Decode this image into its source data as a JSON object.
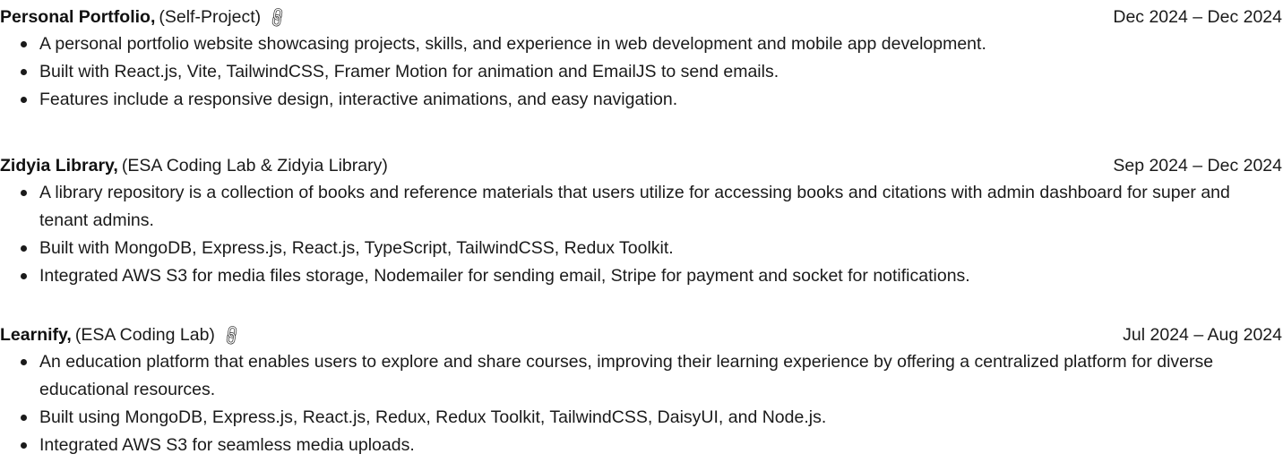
{
  "projects": [
    {
      "name": "Personal Portfolio,",
      "org": "(Self-Project)",
      "has_link": true,
      "link_icon": "link-icon",
      "date": "Dec 2024 – Dec 2024",
      "bullets": [
        "A personal portfolio website showcasing projects, skills, and experience in web development and mobile app development.",
        "Built with React.js, Vite, TailwindCSS, Framer Motion for animation and EmailJS to send emails.",
        "Features include a responsive design, interactive animations, and easy navigation."
      ]
    },
    {
      "name": "Zidyia Library,",
      "org": "(ESA Coding Lab & Zidyia Library)",
      "has_link": false,
      "date": "Sep 2024 – Dec 2024",
      "bullets": [
        "A library repository is a collection of books and reference materials that users utilize for  accessing books and citations with admin dashboard for super and tenant admins.",
        "Built with MongoDB, Express.js, React.js, TypeScript, TailwindCSS, Redux Toolkit.",
        "Integrated AWS S3 for media files storage, Nodemailer for sending email, Stripe for payment and socket for notifications."
      ]
    },
    {
      "name": "Learnify,",
      "org": "(ESA Coding Lab)",
      "has_link": true,
      "link_icon": "link-icon",
      "date": "Jul 2024 – Aug 2024",
      "bullets": [
        "An education platform that enables users to explore and share courses, improving their learning experience by offering a centralized platform for diverse educational resources.",
        "Built using MongoDB, Express.js, React.js, Redux, Redux Toolkit, TailwindCSS, DaisyUI, and Node.js.",
        "Integrated AWS S3 for seamless media uploads."
      ]
    }
  ]
}
